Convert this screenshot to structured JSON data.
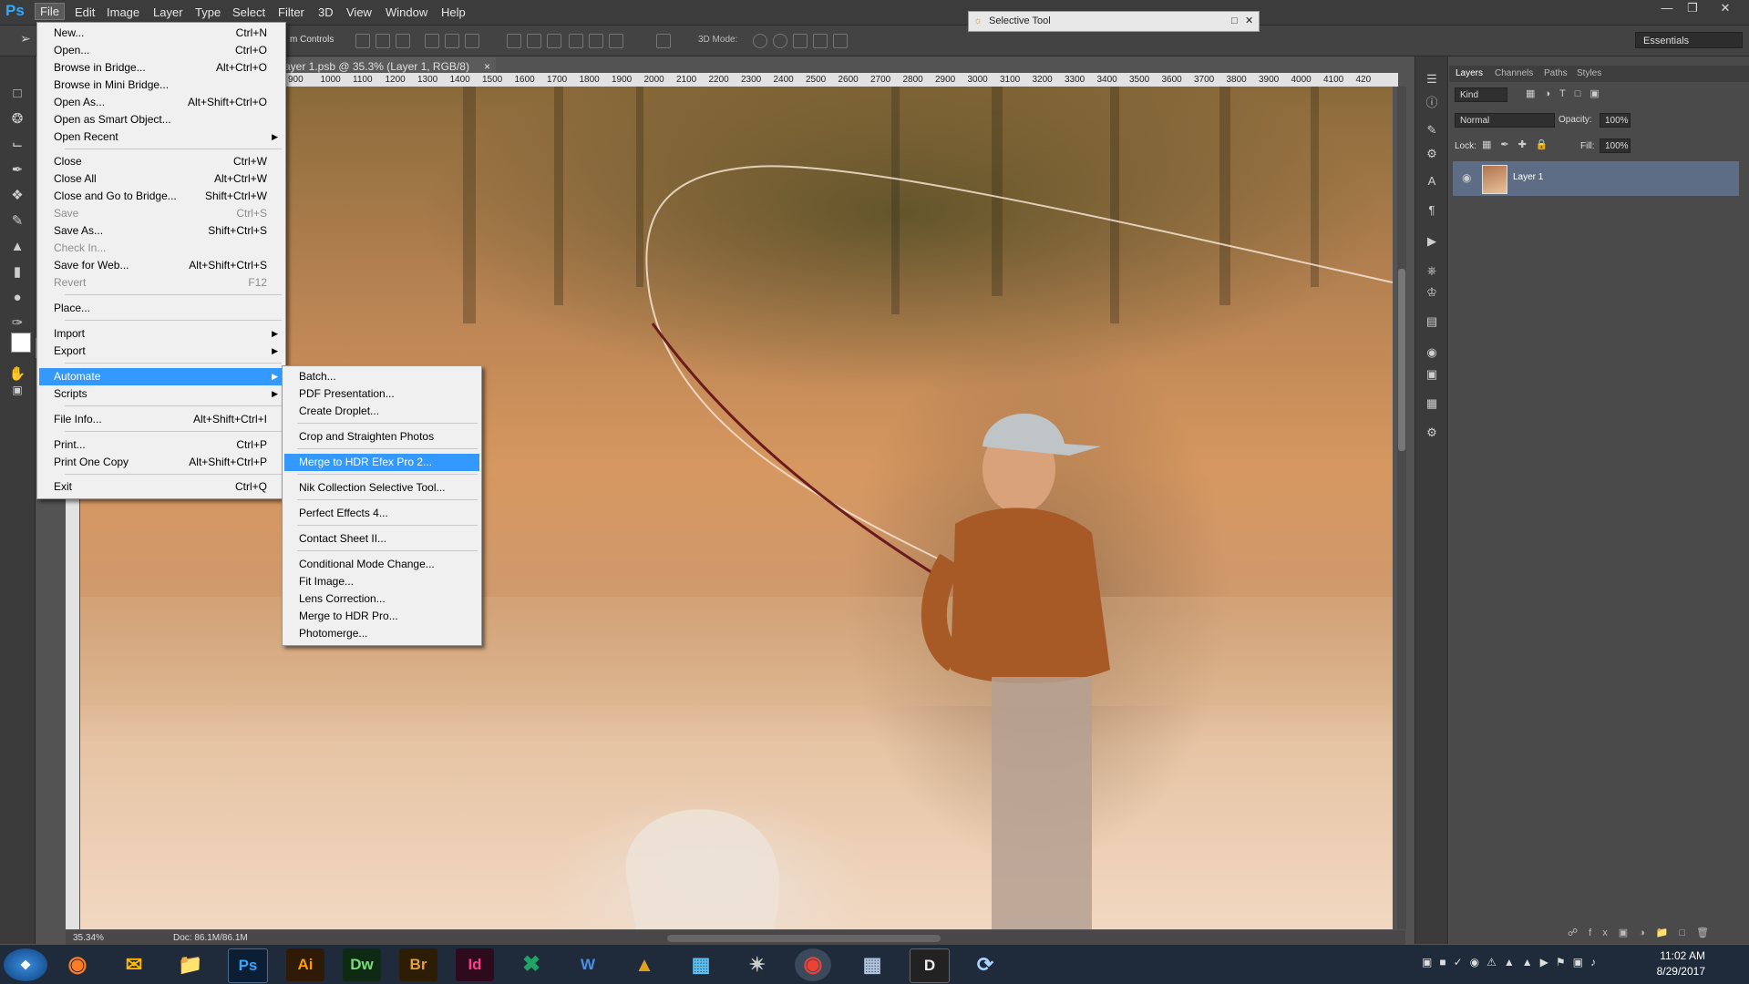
{
  "app": {
    "logo": "Ps"
  },
  "menubar": [
    "File",
    "Edit",
    "Image",
    "Layer",
    "Type",
    "Select",
    "Filter",
    "3D",
    "View",
    "Window",
    "Help"
  ],
  "options_bar": {
    "controls_label": "m Controls",
    "mode_3d_label": "3D Mode:",
    "workspace": "Essentials"
  },
  "selective_tool": {
    "title": "Selective Tool"
  },
  "document": {
    "tab_title": "ayer 1.psb @ 35.3% (Layer 1, RGB/8)",
    "ruler_ticks": [
      "900",
      "1000",
      "1100",
      "1200",
      "1300",
      "1400",
      "1500",
      "1600",
      "1700",
      "1800",
      "1900",
      "2000",
      "2100",
      "2200",
      "2300",
      "2400",
      "2500",
      "2600",
      "2700",
      "2800",
      "2900",
      "3000",
      "3100",
      "3200",
      "3300",
      "3400",
      "3500",
      "3600",
      "3700",
      "3800",
      "3900",
      "4000",
      "4100",
      "420"
    ],
    "zoom": "35.34%",
    "doc_size": "Doc: 86.1M/86.1M"
  },
  "file_menu": {
    "items": [
      {
        "label": "New...",
        "shortcut": "Ctrl+N"
      },
      {
        "label": "Open...",
        "shortcut": "Ctrl+O"
      },
      {
        "label": "Browse in Bridge...",
        "shortcut": "Alt+Ctrl+O"
      },
      {
        "label": "Browse in Mini Bridge...",
        "shortcut": ""
      },
      {
        "label": "Open As...",
        "shortcut": "Alt+Shift+Ctrl+O"
      },
      {
        "label": "Open as Smart Object...",
        "shortcut": ""
      },
      {
        "label": "Open Recent",
        "shortcut": ""
      },
      {
        "label": "Close",
        "shortcut": "Ctrl+W"
      },
      {
        "label": "Close All",
        "shortcut": "Alt+Ctrl+W"
      },
      {
        "label": "Close and Go to Bridge...",
        "shortcut": "Shift+Ctrl+W"
      },
      {
        "label": "Save",
        "shortcut": "Ctrl+S"
      },
      {
        "label": "Save As...",
        "shortcut": "Shift+Ctrl+S"
      },
      {
        "label": "Check In...",
        "shortcut": ""
      },
      {
        "label": "Save for Web...",
        "shortcut": "Alt+Shift+Ctrl+S"
      },
      {
        "label": "Revert",
        "shortcut": "F12"
      },
      {
        "label": "Place...",
        "shortcut": ""
      },
      {
        "label": "Import",
        "shortcut": ""
      },
      {
        "label": "Export",
        "shortcut": ""
      },
      {
        "label": "Automate",
        "shortcut": ""
      },
      {
        "label": "Scripts",
        "shortcut": ""
      },
      {
        "label": "File Info...",
        "shortcut": "Alt+Shift+Ctrl+I"
      },
      {
        "label": "Print...",
        "shortcut": "Ctrl+P"
      },
      {
        "label": "Print One Copy",
        "shortcut": "Alt+Shift+Ctrl+P"
      },
      {
        "label": "Exit",
        "shortcut": "Ctrl+Q"
      }
    ]
  },
  "automate_menu": {
    "items": [
      "Batch...",
      "PDF Presentation...",
      "Create Droplet...",
      "Crop and Straighten Photos",
      "Merge to HDR Efex Pro 2...",
      "Nik Collection Selective Tool...",
      "Perfect Effects 4...",
      "Contact Sheet II...",
      "Conditional Mode Change...",
      "Fit Image...",
      "Lens Correction...",
      "Merge to HDR Pro...",
      "Photomerge..."
    ]
  },
  "layers_panel": {
    "tabs": [
      "Layers",
      "Channels",
      "Paths",
      "Styles"
    ],
    "kind": "Kind",
    "blend_mode": "Normal",
    "opacity_label": "Opacity:",
    "opacity_value": "100%",
    "lock_label": "Lock:",
    "fill_label": "Fill:",
    "fill_value": "100%",
    "layer_name": "Layer 1"
  },
  "taskbar": {
    "time": "11:02 AM",
    "date": "8/29/2017",
    "apps": [
      "Ai",
      "Dw",
      "Br",
      "Id",
      "W",
      "D"
    ]
  }
}
